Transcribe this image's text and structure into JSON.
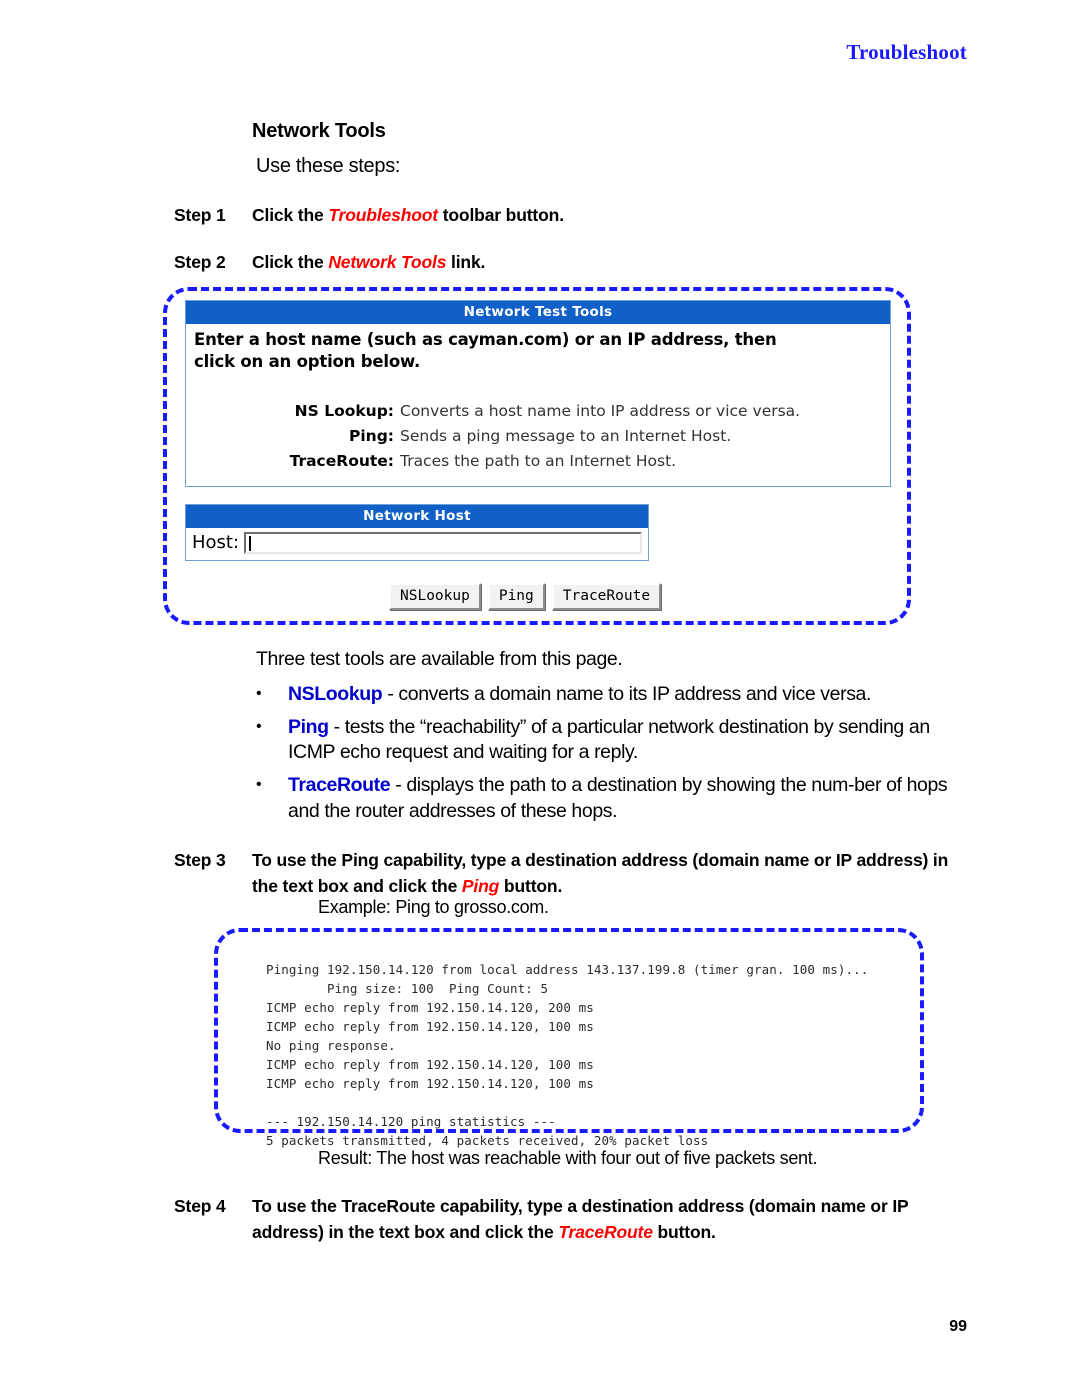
{
  "running_head": "Troubleshoot",
  "section": {
    "title": "Network Tools",
    "lead": "Use these steps:"
  },
  "steps": [
    {
      "label": "Step 1",
      "text_before": "Click the ",
      "emphasis": "Troubleshoot",
      "text_after": " toolbar button."
    },
    {
      "label": "Step 2",
      "text_before": "Click the ",
      "emphasis": "Network Tools",
      "text_after": " link."
    },
    {
      "label": "Step 3",
      "text_before": "To use the Ping capability, type a destination address (domain name or IP address) in the text box and click the ",
      "emphasis": "Ping",
      "text_after": " button."
    },
    {
      "label": "Step 4",
      "text_before": "To use the TraceRoute capability, type a destination address (domain name or IP address) in the text box and click the ",
      "emphasis": "TraceRoute",
      "text_after": " button."
    }
  ],
  "example_line": "Example: Ping to grosso.com.",
  "result_line": "Result: The host was reachable with four out of five packets sent.",
  "screenshot": {
    "test_tools_panel": {
      "title": "Network Test Tools",
      "intro_line_1": "Enter a host name (such as cayman.com) or an IP address, then",
      "intro_line_2": "click on an option below.",
      "definitions": [
        {
          "name": "NS Lookup:",
          "description": "Converts a host name into IP address or vice versa."
        },
        {
          "name": "Ping:",
          "description": "Sends a ping message to an Internet Host."
        },
        {
          "name": "TraceRoute:",
          "description": "Traces the path to an Internet Host."
        }
      ]
    },
    "network_host_panel": {
      "title": "Network Host",
      "host_label": "Host:",
      "host_value": "",
      "host_placeholder": ""
    },
    "buttons": [
      {
        "label": "NSLookup"
      },
      {
        "label": "Ping"
      },
      {
        "label": "TraceRoute"
      }
    ]
  },
  "body": {
    "intro": "Three test tools are available from this page.",
    "bullet_marker": "•",
    "bullets": [
      {
        "tool": "NSLookup",
        "text": " - converts a domain name to its IP address and vice versa."
      },
      {
        "tool": "Ping",
        "text": " - tests the “reachability” of a particular network destination by sending an ICMP echo request and waiting for a reply."
      },
      {
        "tool": "TraceRoute",
        "text": " - displays the path to a destination by showing the num-ber of hops and the router addresses of these hops."
      }
    ]
  },
  "ping_output": "Pinging 192.150.14.120 from local address 143.137.199.8 (timer gran. 100 ms)...\n        Ping size: 100  Ping Count: 5\nICMP echo reply from 192.150.14.120, 200 ms\nICMP echo reply from 192.150.14.120, 100 ms\nNo ping response.\nICMP echo reply from 192.150.14.120, 100 ms\nICMP echo reply from 192.150.14.120, 100 ms\n\n--- 192.150.14.120 ping statistics ---\n5 packets transmitted, 4 packets received, 20% packet loss",
  "folio": "99",
  "colors": {
    "running_head": "#1a1aff",
    "callout_border": "#1a1aff",
    "panel_title_bg": "#1060c8",
    "emphasis_red": "#ff0000",
    "tool_name_blue": "#0000cc"
  }
}
